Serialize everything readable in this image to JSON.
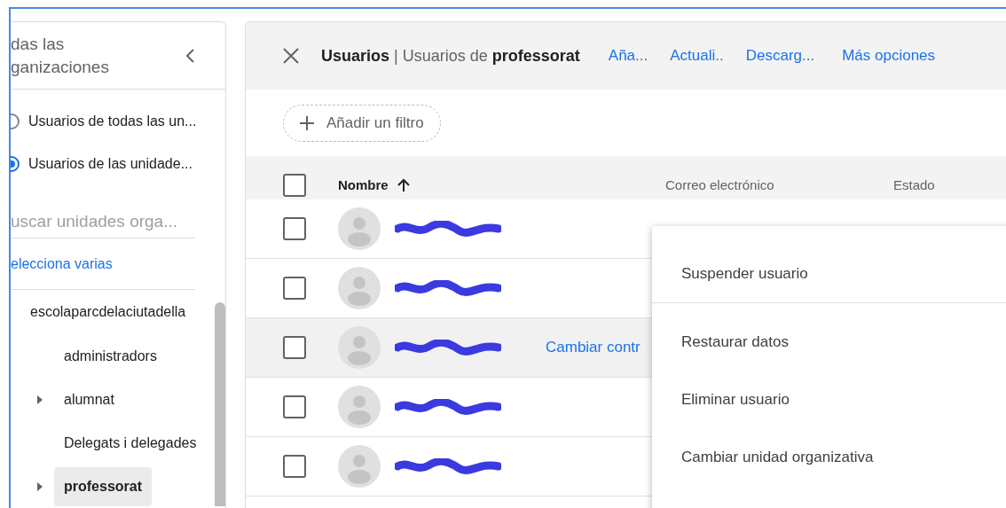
{
  "sidebar": {
    "title_lines": [
      "das las",
      "ganizaciones"
    ],
    "scopes": [
      {
        "label": "Usuarios de todas las un...",
        "selected": false
      },
      {
        "label": "Usuarios de las unidade...",
        "selected": true
      }
    ],
    "search": {
      "placeholder": "uscar unidades orga..."
    },
    "multi_select_link": "elecciona varias",
    "tree": [
      {
        "label": "escolaparcdelaciutadella",
        "selected": false,
        "children": [
          {
            "label": "administradors",
            "selected": false,
            "expandable": false
          },
          {
            "label": "alumnat",
            "selected": false,
            "expandable": true
          },
          {
            "label": "Delegats i delegades",
            "selected": false,
            "expandable": false
          },
          {
            "label": "professorat",
            "selected": true,
            "expandable": true
          }
        ]
      }
    ]
  },
  "header": {
    "title": "**Usuarios** | Usuarios de **professorat**",
    "actions": [
      "Aña...",
      "Actuali..",
      "Descarg...",
      "Más opciones"
    ]
  },
  "filter_button": "Añadir un filtro",
  "table": {
    "header_checked": false,
    "columns": [
      {
        "label": "Nombre",
        "sorted": true
      },
      {
        "label": "Correo electrónico",
        "sorted": false
      },
      {
        "label": "Estado",
        "sorted": false
      }
    ],
    "rows": [
      {
        "checked": false,
        "hovered": false
      },
      {
        "checked": false,
        "hovered": false
      },
      {
        "checked": false,
        "hovered": true,
        "hover_action": "Cambiar contr"
      },
      {
        "checked": false,
        "hovered": false
      },
      {
        "checked": false,
        "hovered": false
      }
    ]
  },
  "menu": {
    "items": [
      {
        "label": "Suspender usuario",
        "divider_after": true
      },
      {
        "label": "Restaurar datos",
        "divider_after": false
      },
      {
        "label": "Eliminar usuario",
        "divider_after": false
      },
      {
        "label": "Cambiar unidad organizativa",
        "divider_after": false
      }
    ]
  }
}
